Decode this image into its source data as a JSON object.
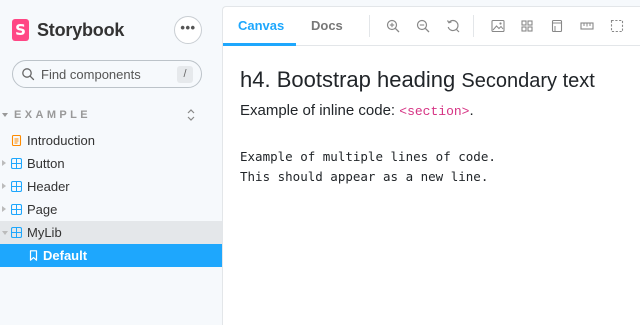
{
  "brand": {
    "name": "Storybook",
    "logo_letter": "S",
    "color": "#ff4785"
  },
  "menu_button": {
    "label": "•••"
  },
  "search": {
    "placeholder": "Find components",
    "shortcut": "/"
  },
  "section": {
    "title": "EXAMPLE"
  },
  "tree": [
    {
      "label": "Introduction",
      "icon": "document-icon"
    },
    {
      "label": "Button",
      "icon": "component-icon"
    },
    {
      "label": "Header",
      "icon": "component-icon"
    },
    {
      "label": "Page",
      "icon": "component-icon"
    },
    {
      "label": "MyLib",
      "icon": "component-icon",
      "expanded": true
    },
    {
      "label": "Default",
      "icon": "bookmark-icon",
      "selected": true
    }
  ],
  "tabs": [
    {
      "label": "Canvas",
      "active": true
    },
    {
      "label": "Docs",
      "active": false
    }
  ],
  "toolbar_icons": [
    "zoom-in-icon",
    "zoom-out-icon",
    "zoom-reset-icon",
    "background-icon",
    "grid-icon",
    "viewport-icon",
    "measure-icon",
    "outline-icon"
  ],
  "content": {
    "heading": "h4. Bootstrap heading",
    "heading_secondary": "Secondary text",
    "inline_prefix": "Example of inline code: ",
    "inline_code": "<section>",
    "inline_suffix": ".",
    "code_lines": "Example of multiple lines of code.\nThis should appear as a new line."
  },
  "colors": {
    "accent": "#1ea7fd",
    "code": "#d63384"
  }
}
